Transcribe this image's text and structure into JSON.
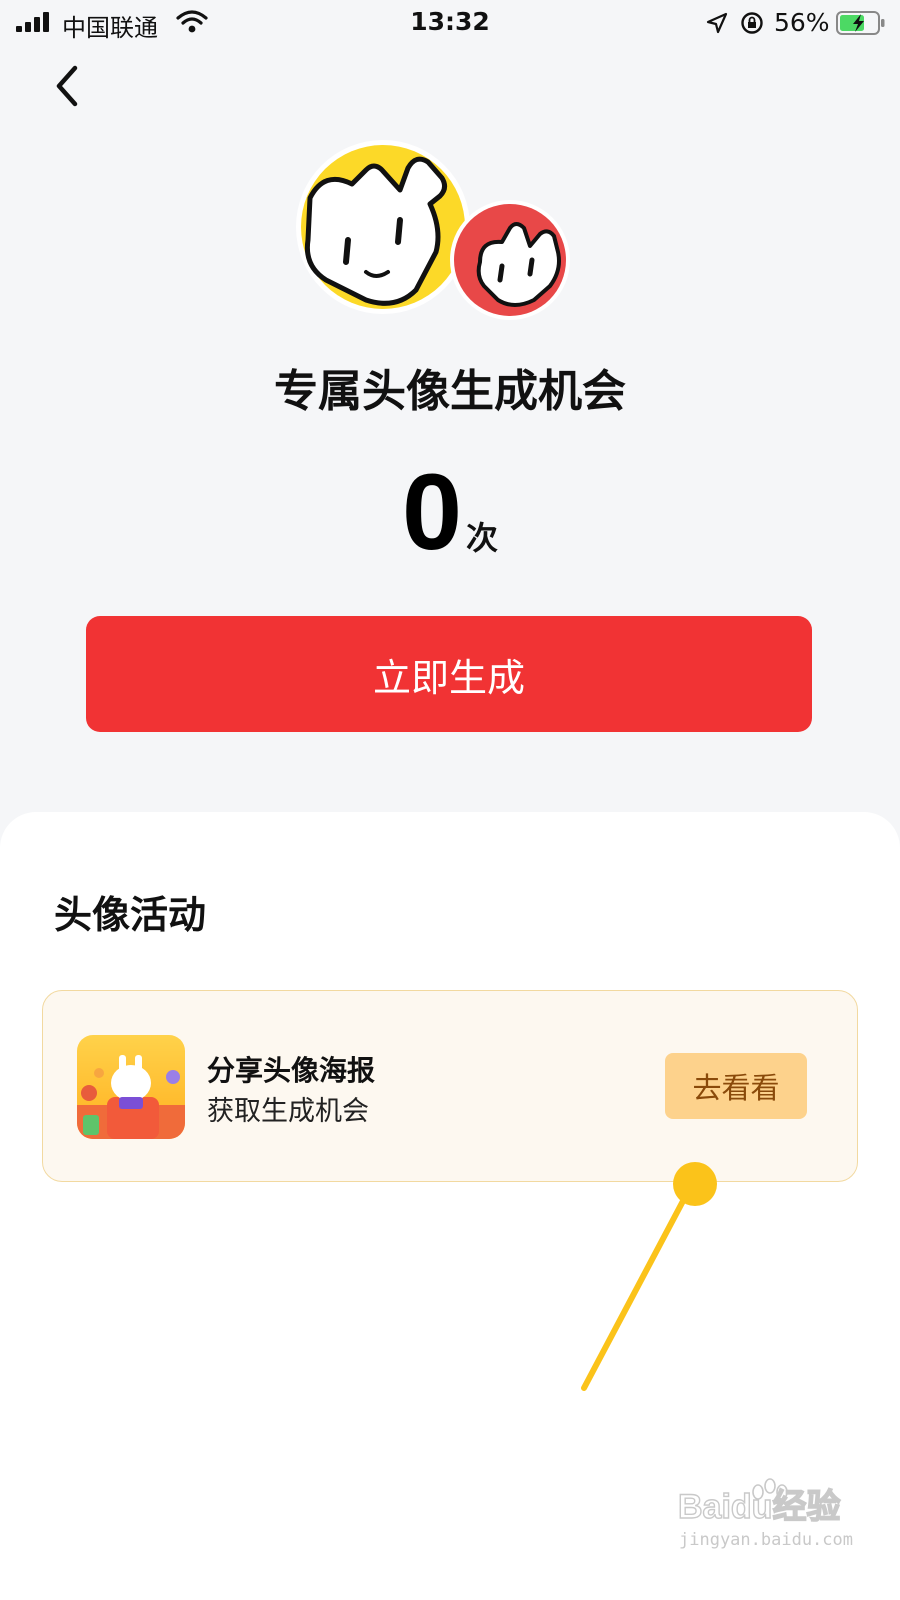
{
  "status_bar": {
    "carrier": "中国联通",
    "time": "13:32",
    "battery_percent": "56%"
  },
  "header": {
    "back_icon": "chevron-left-icon"
  },
  "hero": {
    "title": "专属头像生成机会",
    "count": "0",
    "count_unit": "次",
    "generate_label": "立即生成"
  },
  "activities": {
    "section_title": "头像活动",
    "items": [
      {
        "title": "分享头像海报",
        "description": "获取生成机会",
        "action_label": "去看看"
      }
    ]
  },
  "watermark": {
    "brand": "Baidu经验",
    "url": "jingyan.baidu.com"
  },
  "colors": {
    "primary_red": "#f13334",
    "button_yellow": "#fdd28c",
    "card_bg": "#fdf8f0",
    "annotation_yellow": "#fbc31a"
  }
}
